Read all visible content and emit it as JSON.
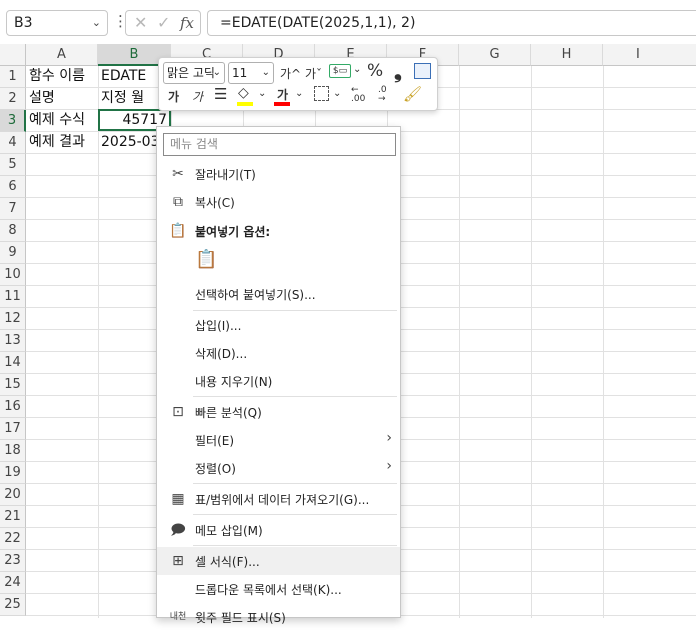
{
  "formula_bar": {
    "name_box": "B3",
    "cancel_icon": "✕",
    "enter_icon": "✓",
    "fx_label": "fx",
    "formula": "=EDATE(DATE(2025,1,1), 2)"
  },
  "columns": [
    "A",
    "B",
    "C",
    "D",
    "E",
    "F",
    "G",
    "H",
    "I"
  ],
  "rows": [
    "1",
    "2",
    "3",
    "4",
    "5",
    "6",
    "7",
    "8",
    "9",
    "10",
    "11",
    "12",
    "13",
    "14",
    "15",
    "16",
    "17",
    "18",
    "19",
    "20",
    "21",
    "22",
    "23",
    "24",
    "25"
  ],
  "cells": {
    "A1": "함수 이름",
    "B1": "EDATE",
    "A2": "설명",
    "B2": "지정 월",
    "A3": "예제 수식",
    "B3": "45717",
    "A4": "예제 결과",
    "B4": "2025-03"
  },
  "mini_toolbar": {
    "font_name": "맑은 고딕",
    "font_size": "11",
    "grow_font": "가^",
    "shrink_font": "가ˇ",
    "percent": "%",
    "comma": "❟",
    "bold": "가",
    "italic": "가",
    "font_color_label": "가",
    "fill_color": "#ffff00",
    "font_color": "#ff0000",
    "inc_decimal": ".00",
    "dec_decimal": ".0"
  },
  "context_menu": {
    "search_placeholder": "메뉴 검색",
    "items": [
      {
        "label": "잘라내기(T)",
        "icon": "scissors-icon"
      },
      {
        "label": "복사(C)",
        "icon": "copy-icon"
      },
      {
        "label": "붙여넣기 옵션:",
        "icon": "paste-icon"
      },
      {
        "label": "선택하여 붙여넣기(S)...",
        "icon": ""
      },
      {
        "label": "삽입(I)...",
        "icon": ""
      },
      {
        "label": "삭제(D)...",
        "icon": ""
      },
      {
        "label": "내용 지우기(N)",
        "icon": ""
      },
      {
        "label": "빠른 분석(Q)",
        "icon": "quick-analysis-icon"
      },
      {
        "label": "필터(E)",
        "icon": ""
      },
      {
        "label": "정렬(O)",
        "icon": ""
      },
      {
        "label": "표/범위에서 데이터 가져오기(G)...",
        "icon": "table-icon"
      },
      {
        "label": "메모 삽입(M)",
        "icon": "note-icon"
      },
      {
        "label": "셀 서식(F)...",
        "icon": "format-cells-icon"
      },
      {
        "label": "드롭다운 목록에서 선택(K)...",
        "icon": ""
      },
      {
        "label": "윗주 필드 표시(S)",
        "icon": "phonetic-icon"
      }
    ]
  },
  "colors": {
    "accent": "#217346",
    "header_bg": "#f3f3f3"
  }
}
